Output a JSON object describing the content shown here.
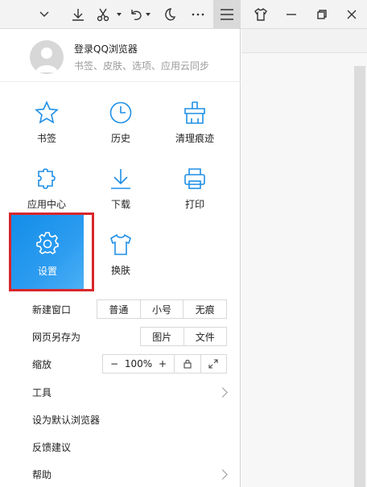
{
  "toolbar": {
    "icons": [
      "chevron-down-icon",
      "download-icon",
      "scissors-icon",
      "undo-icon",
      "night-mode-icon",
      "more-icon",
      "menu-icon",
      "skin-icon",
      "minimize-icon",
      "restore-icon",
      "close-icon"
    ]
  },
  "account": {
    "title": "登录QQ浏览器",
    "subtitle": "书签、皮肤、选项、应用云同步"
  },
  "grid": {
    "items": [
      {
        "label": "书签",
        "icon": "star-icon"
      },
      {
        "label": "历史",
        "icon": "clock-icon"
      },
      {
        "label": "清理痕迹",
        "icon": "broom-icon"
      },
      {
        "label": "应用中心",
        "icon": "puzzle-icon"
      },
      {
        "label": "下载",
        "icon": "download-icon"
      },
      {
        "label": "打印",
        "icon": "printer-icon"
      },
      {
        "label": "设置",
        "icon": "gear-icon"
      },
      {
        "label": "换肤",
        "icon": "tshirt-icon"
      }
    ],
    "accent": "#1f8fe6",
    "selected_tile": "#1e93ec",
    "highlight": "#d9262b"
  },
  "options": {
    "new_window": {
      "label": "新建窗口",
      "buttons": [
        "普通",
        "小号",
        "无痕"
      ]
    },
    "save_page": {
      "label": "网页另存为",
      "buttons": [
        "图片",
        "文件"
      ]
    },
    "zoom": {
      "label": "缩放",
      "minus": "−",
      "value": "100%",
      "plus": "+"
    },
    "tools": {
      "label": "工具"
    },
    "default_browser": {
      "label": "设为默认浏览器"
    },
    "feedback": {
      "label": "反馈建议"
    },
    "help": {
      "label": "帮助"
    }
  }
}
